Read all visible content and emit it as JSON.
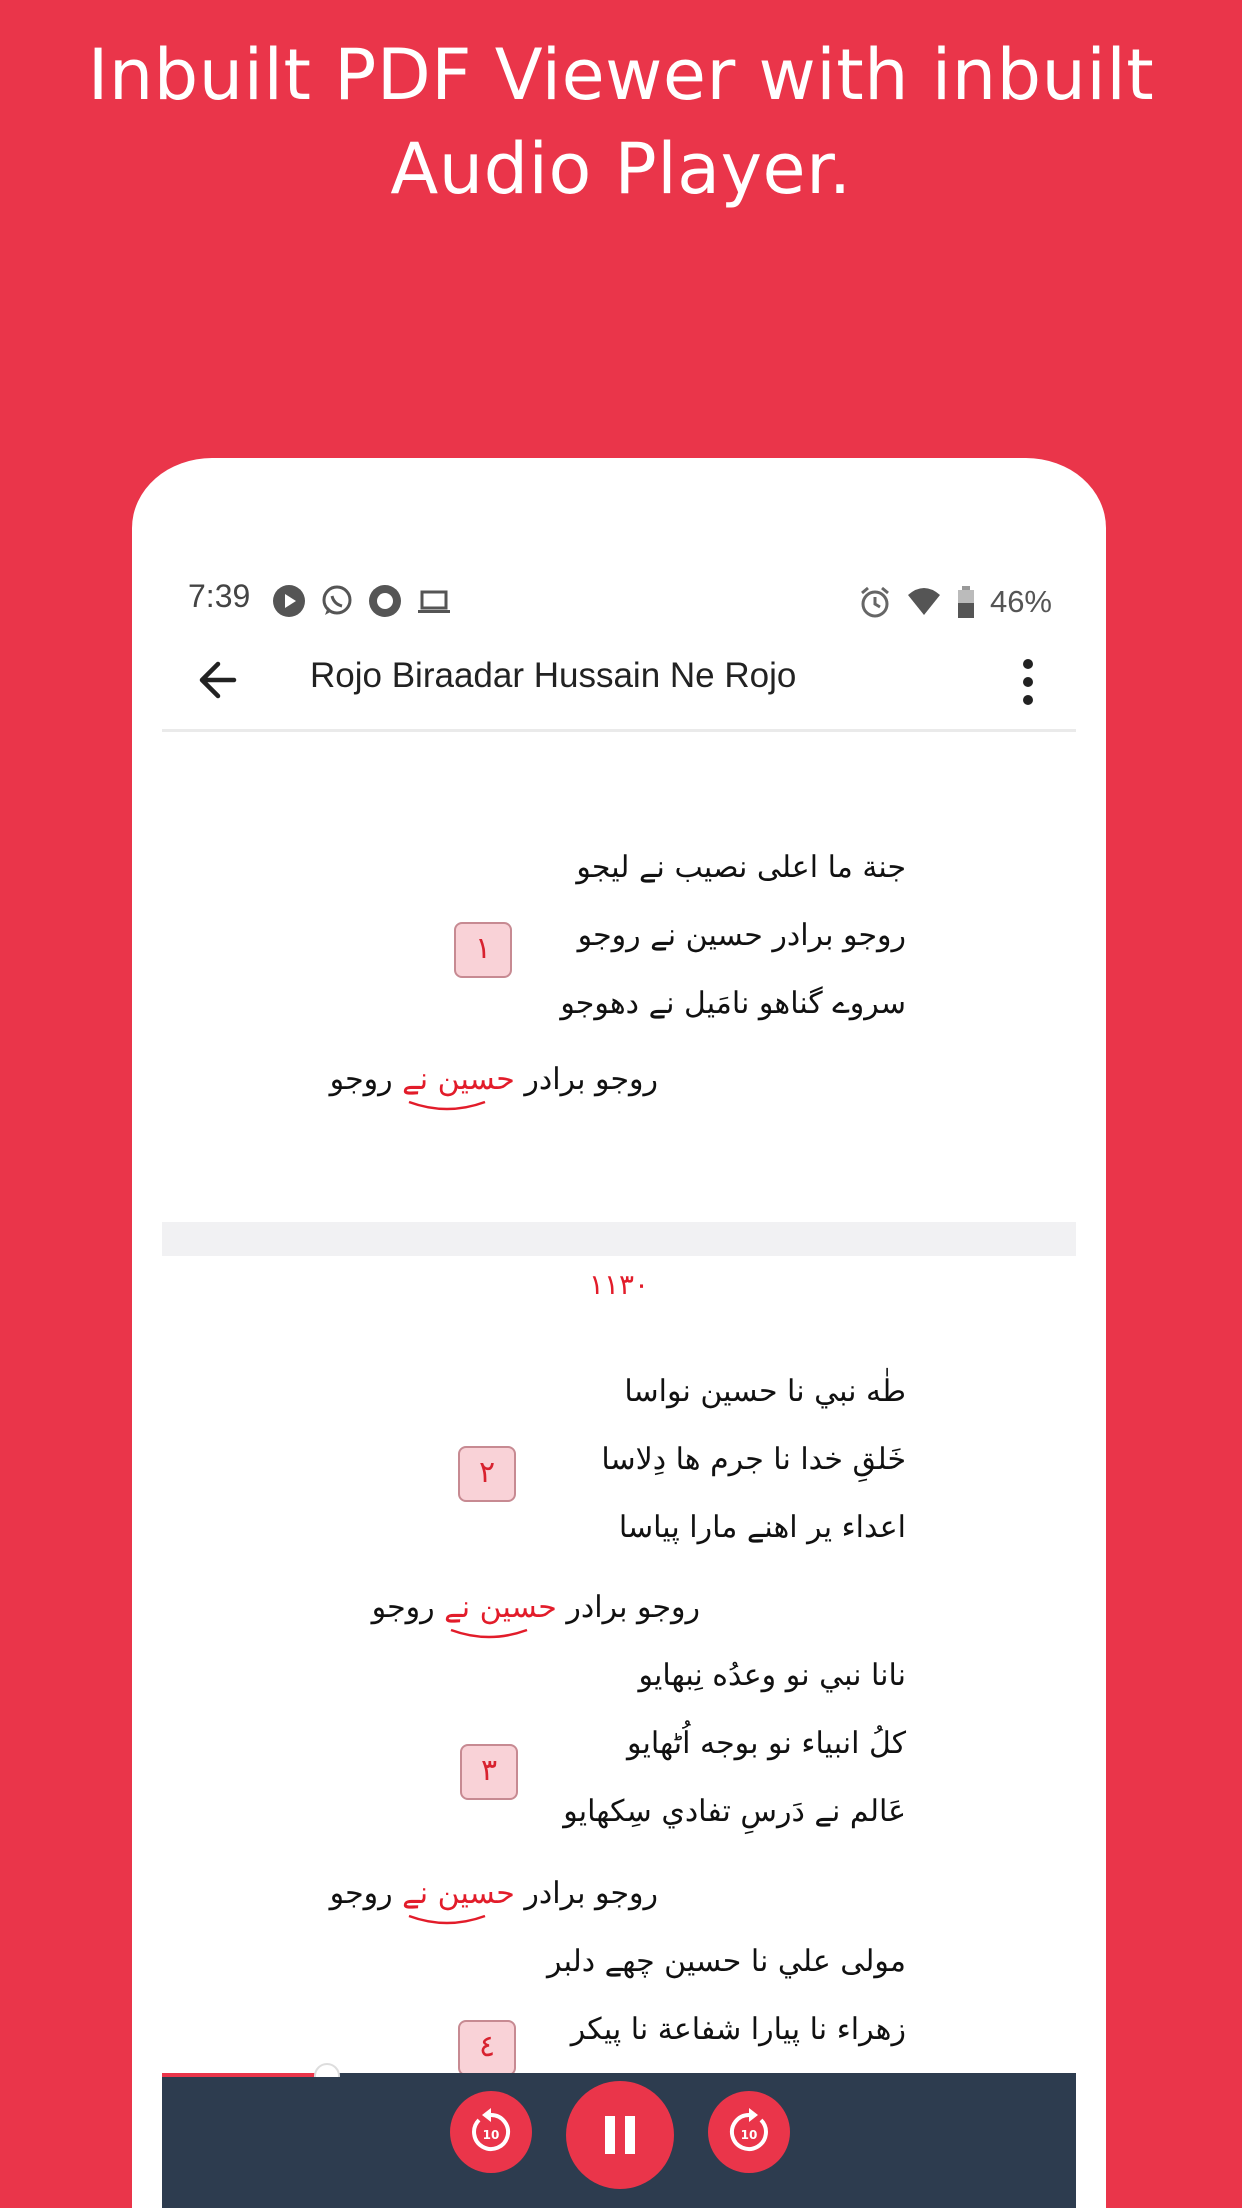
{
  "headline": "Inbuilt PDF Viewer with inbuilt Audio Player.",
  "status_bar": {
    "time": "7:39",
    "left_icons": [
      "play-store-icon",
      "whatsapp-icon",
      "app-icon",
      "laptop-icon"
    ],
    "right_icons": [
      "alarm-icon",
      "wifi-icon",
      "battery-icon"
    ],
    "battery": "46%"
  },
  "app_bar": {
    "title": "Rojo Biraadar Hussain Ne Rojo"
  },
  "document": {
    "page1": {
      "lines": [
        "جنة ما اعلى نصيب نے ليجو",
        "روجو برادر حسين نے روجو",
        "سروے گناهو نامَيل نے دهوجو"
      ],
      "badge": "١",
      "refrain_pre": "روجو برادر ",
      "refrain_red": "حسين نے",
      "refrain_post": " روجو"
    },
    "page_number": "١١٣٠",
    "page2": {
      "stanza2": [
        "طٰه نبي نا حسين نواسا",
        "خَلقِ خدا نا جرم ها دِلاسا",
        "اعداء ير اهنے مارا پياسا"
      ],
      "badge2": "٢",
      "refrain_pre": "روجو برادر ",
      "refrain_red": "حسين نے",
      "refrain_post": " روجو",
      "stanza3": [
        "نانا نبي نو وعدُه نِبهايو",
        "كلُ انبياء نو بوجه اُٹھايو",
        "عَالم نے دَرسِ تفادي سِكهايو"
      ],
      "badge3": "٣",
      "stanza4": [
        "مولى علي نا حسين چهے دلبر",
        "زهراء نا پيارا شفاعة نا پيكر"
      ],
      "badge4": "٤"
    }
  },
  "player": {
    "progress": 0.18,
    "rewind_label": "10",
    "forward_label": "10",
    "state": "playing"
  }
}
